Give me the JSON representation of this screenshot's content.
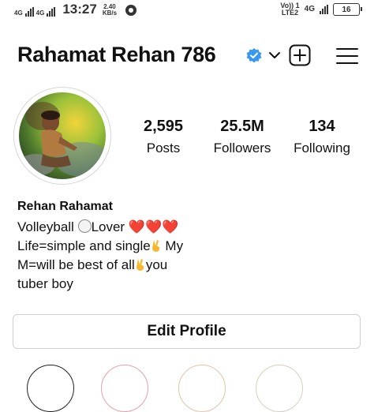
{
  "status_bar": {
    "network_left_1": "4G",
    "network_left_2": "4G",
    "time": "13:27",
    "speed_value": "2.40",
    "speed_unit": "KB/s",
    "volte": "Vo)) 1",
    "lte": "LTE2",
    "network_right": "4G",
    "battery": "16"
  },
  "header": {
    "username": "Rahamat Rehan 786",
    "icons": {
      "verified": "verified-badge-icon",
      "chevron": "chevron-down-icon",
      "add": "add-post-icon",
      "menu": "hamburger-menu-icon"
    },
    "accent_color": "#3897f0"
  },
  "stats": {
    "posts_count": "2,595",
    "posts_label": "Posts",
    "followers_count": "25.5M",
    "followers_label": "Followers",
    "following_count": "134",
    "following_label": "Following"
  },
  "bio": {
    "name": "Rehan Rahamat",
    "line1_text": "Volleyball ",
    "line1_after": "Lover ",
    "line1_hearts": "❤️❤️❤️",
    "line2_text": "Life=simple and single",
    "line2_after": " My",
    "line3_text": "M=will be best of all",
    "line3_after": "you",
    "line4_text": "tuber boy"
  },
  "edit_profile_label": "Edit Profile"
}
